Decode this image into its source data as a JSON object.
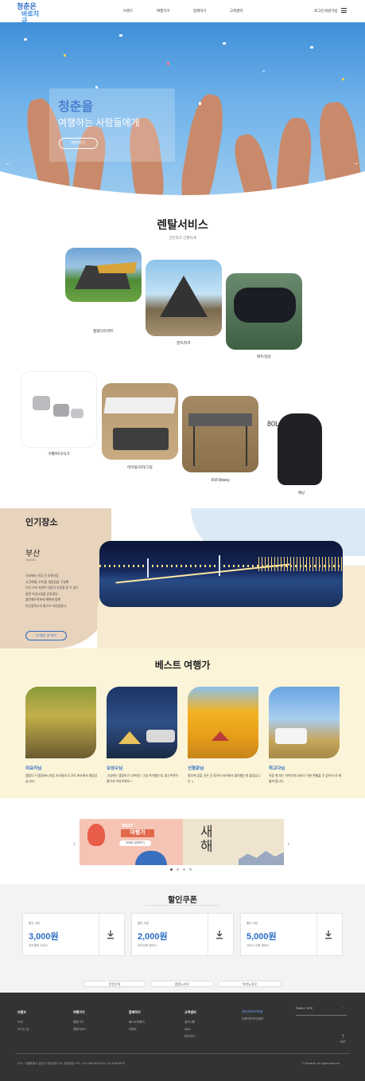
{
  "header": {
    "logo_line1": "청춘은",
    "logo_line2": "바로지금",
    "nav": [
      "브랜드",
      "여행가기",
      "함께하기",
      "고객센터"
    ],
    "login": "로그인",
    "signup": "회원가입",
    "menu_icon": "hamburger-icon"
  },
  "hero": {
    "title": "청춘을",
    "subtitle": "여행하는 사람들에게",
    "button": "예약하기",
    "prev_icon": "arrow-left-icon",
    "next_icon": "arrow-right-icon"
  },
  "rental": {
    "title": "렌탈서비스",
    "subtitle": "간단하고 간편하게",
    "items": [
      "캠핑타프/텐트",
      "텐트/타프",
      "매트/침낭",
      "코펠/버너/식기",
      "테이블/의자/그릴",
      "화로대/BBQ",
      "배낭"
    ]
  },
  "popular": {
    "title": "인기장소",
    "city": "부산",
    "city_en": "BUSAN",
    "desc_lines": [
      "국내에서 가장 긴 모랫사장,",
      "시간여행, 오토캠, 캠핑장을 구경해",
      "다리 가지 자연이 더없이 자연을 알 수 있는",
      "경관 조망시설을 갖추었다.",
      "불턴예수폭포와 해변에 함께",
      "부산광역시의 명소로 자리잡았다."
    ],
    "button": "더 많은 곳 보기"
  },
  "best": {
    "title": "베스트 여행가",
    "cards": [
      {
        "name": "이요리님",
        "desc": "캠핑도구 캠핑에서 처음 자녀들과 도구로 초보에서 재밌었습니다!"
      },
      {
        "name": "오성수님",
        "desc": "그날에는 캠핑하기 나쁘지는 그날 저녁했는데, 청소주변이 좋아서 여유로워요~~"
      },
      {
        "name": "신형준님",
        "desc": "필부에 있을 곳은 곳 찾아서 타이에서 좋아했는데 좋았습니다 :)"
      },
      {
        "name": "최고다님",
        "desc": "처음 해 보는 차박인데 서비스 덕분 편했을 것 같아서 꼭 해 볼까 합니다."
      }
    ]
  },
  "banner": {
    "tag": "BEST",
    "title": "여행가",
    "pill": "이벤트 참여하기",
    "right_text": "새해",
    "prev_icon": "chevron-left-icon",
    "next_icon": "chevron-right-icon"
  },
  "coupon": {
    "title": "할인쿠폰",
    "items": [
      {
        "label": "할인 쿠폰",
        "amount": "3,000원",
        "desc": "모든캠핑 서비스"
      },
      {
        "label": "할인 쿠폰",
        "amount": "2,000원",
        "desc": "무료전화 예약시"
      },
      {
        "label": "할인 쿠폰",
        "amount": "5,000원",
        "desc": "서비스 이용 결제시"
      }
    ],
    "download_icon": "download-icon",
    "links": [
      "안전수칙",
      "캠핑노하우",
      "차박노하우"
    ]
  },
  "footer": {
    "cols": [
      {
        "title": "브랜드",
        "items": [
          "소개",
          "오시는 길"
        ]
      },
      {
        "title": "여행가기",
        "items": [
          "캠핑가기",
          "캠핑서비스"
        ]
      },
      {
        "title": "함께하기",
        "items": [
          "베스트여행가",
          "이벤트"
        ]
      },
      {
        "title": "고객센터",
        "items": [
          "공지사항",
          "Q&A",
          "문의하기"
        ]
      },
      {
        "title": "",
        "items": [
          "개인정보처리방침",
          "이용약관/약관정보"
        ]
      }
    ],
    "family_site": "FAMILY SITE",
    "top": "TOP",
    "address": "주소 : 서울특별시 강남구 강남대로 123, 청춘빌딩     TEL : 02-1234-5678     Fax : 02-1234-5679",
    "copyright": "© Busanes. All rights reserved."
  },
  "colors": {
    "accent": "#2b6cc4",
    "footer_bg": "#333333",
    "best_bg": "#fcf4d8"
  }
}
